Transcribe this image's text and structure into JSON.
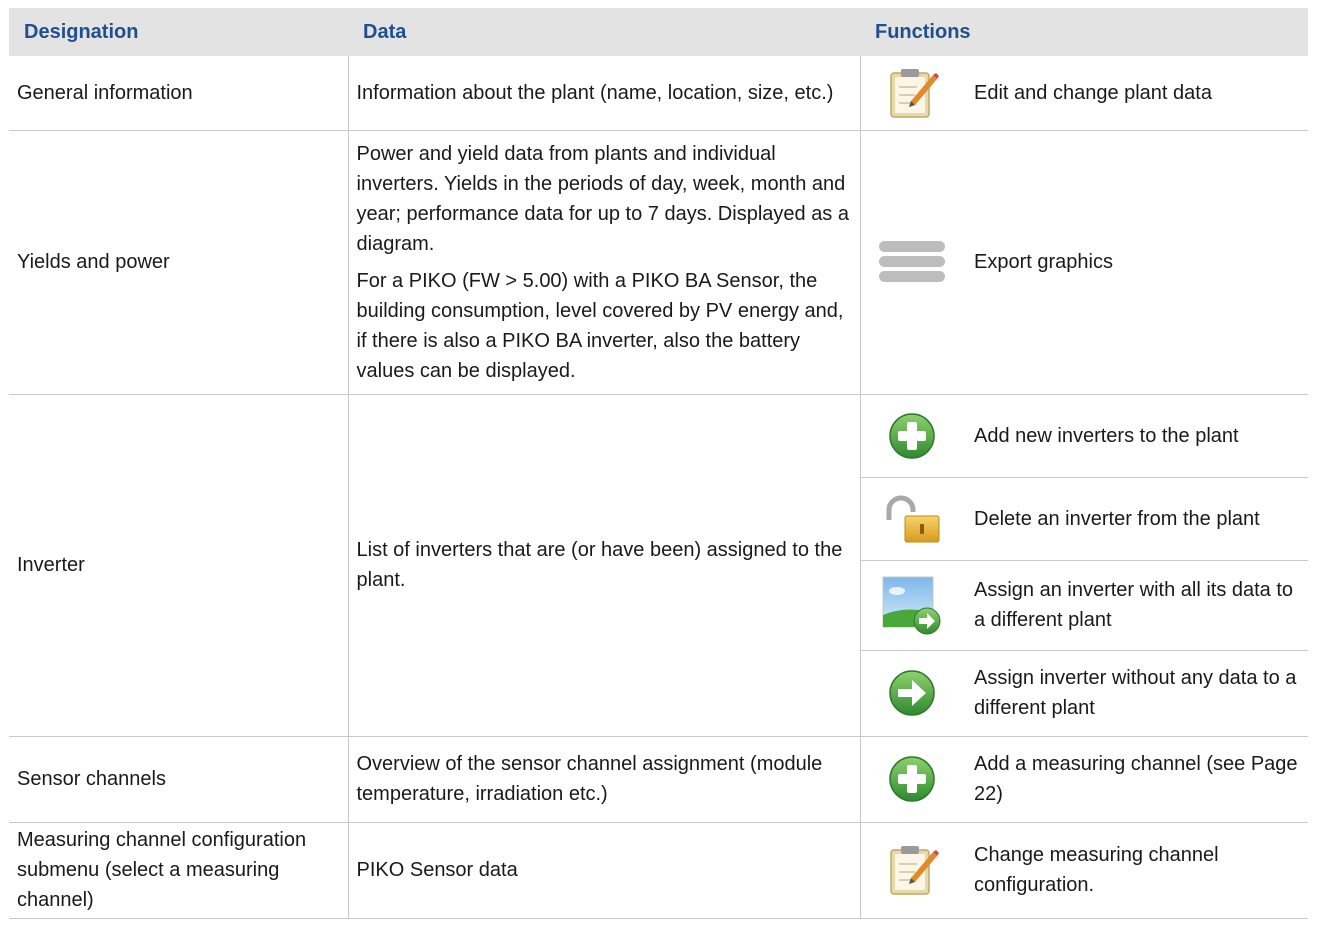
{
  "header": {
    "designation": "Designation",
    "data": "Data",
    "functions": "Functions"
  },
  "rows": [
    {
      "designation": "General information",
      "data": [
        "Information about the plant (name, location, size, etc.)"
      ],
      "functions": [
        {
          "icon": "clipboard-edit-icon",
          "label": "Edit and change plant data"
        }
      ]
    },
    {
      "designation": "Yields and power",
      "data": [
        "Power and yield data from plants and individual inverters. Yields in the periods of day, week, month and year; performance data for up to 7 days. Displayed as a diagram.",
        "For a PIKO (FW > 5.00) with a PIKO BA Sensor, the building consumption, level covered by PV energy and, if there is also a PIKO BA inverter, also the battery values can be displayed."
      ],
      "functions": [
        {
          "icon": "menu-bars-icon",
          "label": "Export graphics"
        }
      ]
    },
    {
      "designation": "Inverter",
      "data": [
        "List of inverters that are (or have been) assigned to the plant."
      ],
      "functions": [
        {
          "icon": "green-plus-icon",
          "label": "Add new inverters to the plant"
        },
        {
          "icon": "unlock-icon",
          "label": "Delete an inverter from the plant"
        },
        {
          "icon": "image-arrow-icon",
          "label": "Assign an inverter with all its data to a different plant"
        },
        {
          "icon": "green-arrow-icon",
          "label": "Assign inverter without any data to a different plant"
        }
      ]
    },
    {
      "designation": "Sensor channels",
      "data": [
        "Overview of the sensor channel assignment (module temperature, irradiation etc.)"
      ],
      "functions": [
        {
          "icon": "green-plus-icon",
          "label": "Add a measuring channel (see Page 22)"
        }
      ]
    },
    {
      "designation": "Measuring channel configuration submenu (select a measuring channel)",
      "data": [
        "PIKO Sensor data"
      ],
      "functions": [
        {
          "icon": "clipboard-edit-icon",
          "label": "Change measuring channel configuration."
        }
      ]
    }
  ],
  "colors": {
    "header_text": "#1f4f8f",
    "header_bg": "#e3e3e3",
    "border": "#c9c9c9",
    "icon_green": "#3a9a3a"
  }
}
